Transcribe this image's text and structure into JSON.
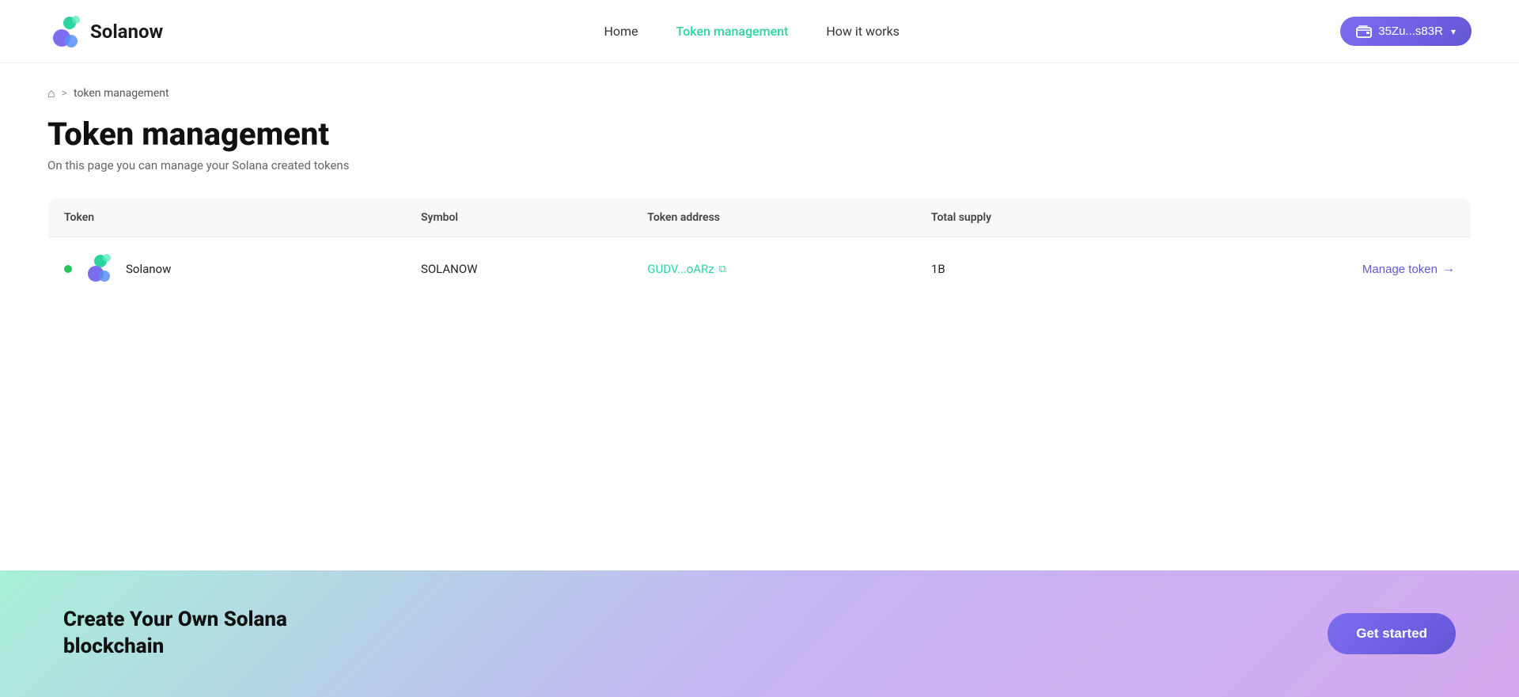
{
  "brand": {
    "name": "Solanow"
  },
  "navbar": {
    "links": [
      {
        "label": "Home",
        "active": false
      },
      {
        "label": "Token management",
        "active": true
      },
      {
        "label": "How it works",
        "active": false
      }
    ],
    "wallet": {
      "label": "35Zu...s83R",
      "icon": "wallet-icon"
    }
  },
  "breadcrumb": {
    "home": "home",
    "separator": ">",
    "current": "token management"
  },
  "page": {
    "title": "Token management",
    "subtitle": "On this page you can manage your Solana created tokens"
  },
  "table": {
    "headers": [
      "Token",
      "Symbol",
      "Token address",
      "Total supply",
      ""
    ],
    "rows": [
      {
        "name": "Solanow",
        "symbol": "SOLANOW",
        "address": "GUDV...oARz",
        "supply": "1B",
        "action": "Manage token"
      }
    ]
  },
  "banner": {
    "title_line1": "Create Your Own Solana",
    "title_line2": "blockchain",
    "cta": "Get started"
  }
}
